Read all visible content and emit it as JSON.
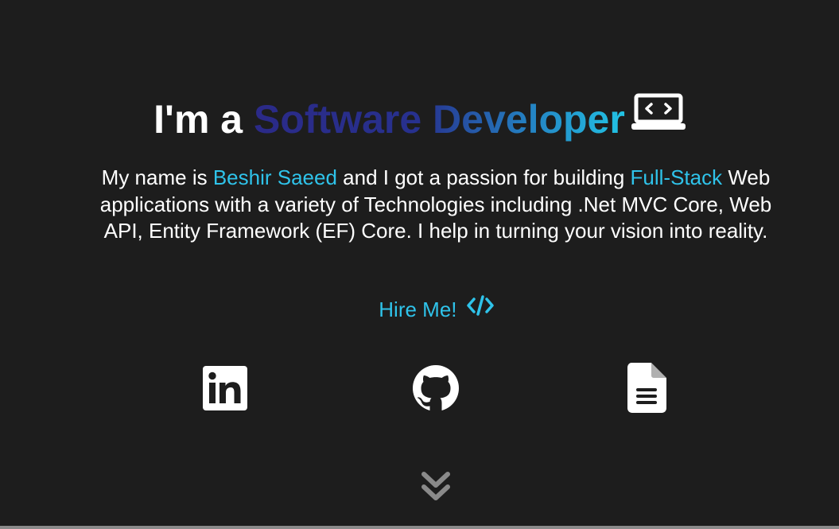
{
  "hero": {
    "headline": {
      "prefix": "I'm a ",
      "role": "Software Developer"
    },
    "intro": {
      "part1": "My name is ",
      "name": "Beshir Saeed",
      "part2": " and I got a passion for building ",
      "focus": "Full-Stack",
      "part3": " Web applications with a variety of Technologies including .Net MVC Core, Web API, Entity Framework (EF) Core. I help in turning your vision into reality."
    },
    "cta": {
      "label": "Hire Me! "
    }
  },
  "icons": {
    "headline": "laptop-code-icon",
    "cta": "code-icon",
    "social": [
      "linkedin-icon",
      "github-icon",
      "document-icon"
    ],
    "scroll": "double-chevron-down-icon"
  },
  "colors": {
    "background": "#1d1d1d",
    "accent": "#2fc3ea",
    "gradient_start": "#2b2a88",
    "gradient_end": "#22c3e4",
    "scroll_indicator": "#8a8a8a"
  }
}
